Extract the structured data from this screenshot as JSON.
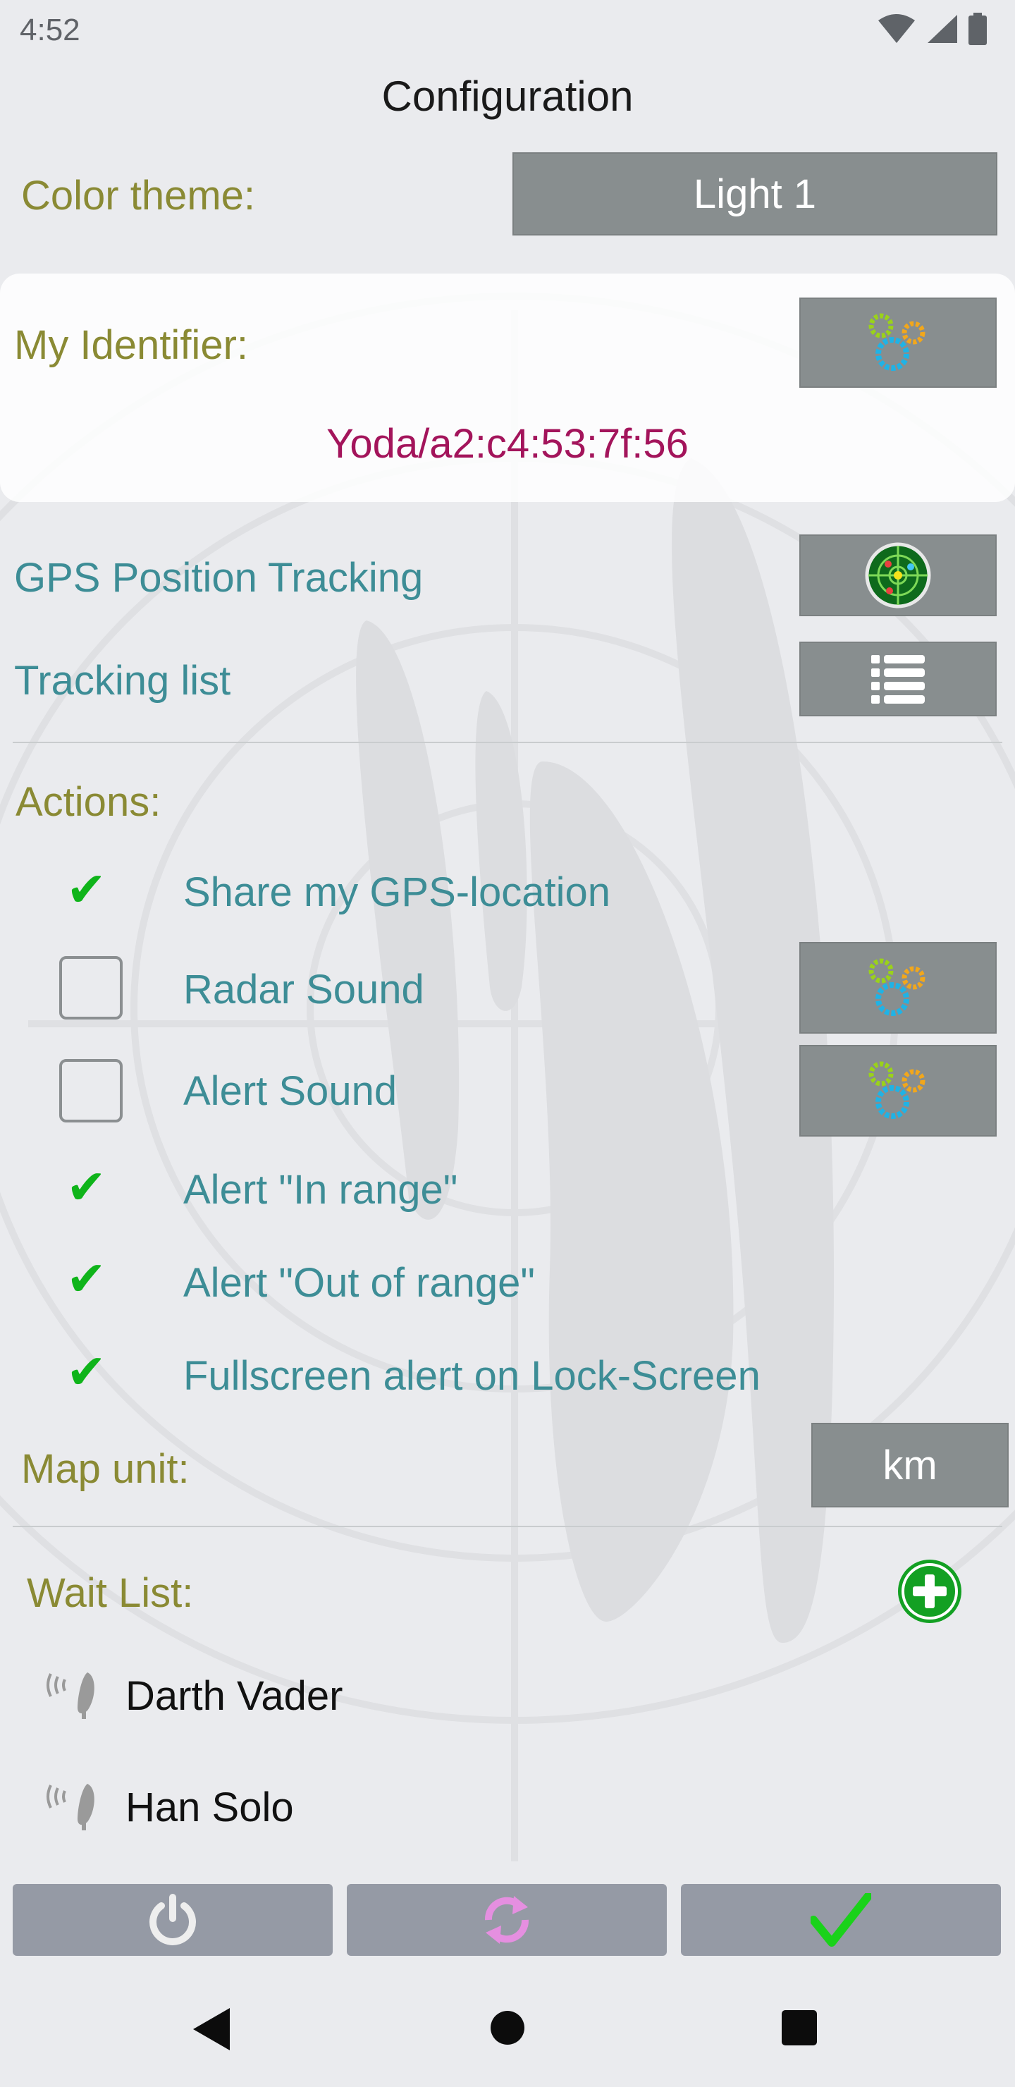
{
  "status_bar": {
    "time": "4:52",
    "icons": [
      "wifi-icon",
      "cell-signal-icon",
      "battery-icon"
    ]
  },
  "header": {
    "title": "Configuration"
  },
  "color_theme": {
    "label": "Color theme:",
    "value": "Light 1"
  },
  "identifier": {
    "label": "My Identifier:",
    "value": "Yoda/a2:c4:53:7f:56",
    "button_icon": "gears-icon"
  },
  "gps_tracking": {
    "label": "GPS Position Tracking",
    "button_icon": "radar-icon"
  },
  "tracking_list": {
    "label": "Tracking list",
    "button_icon": "list-icon"
  },
  "actions": {
    "heading": "Actions:",
    "items": [
      {
        "label": "Share my GPS-location",
        "checked": true
      },
      {
        "label": "Radar Sound",
        "checked": false,
        "settings_icon": "gears-icon"
      },
      {
        "label": "Alert Sound",
        "checked": false,
        "settings_icon": "gears-icon"
      },
      {
        "label": "Alert \"In range\"",
        "checked": true
      },
      {
        "label": "Alert \"Out of range\"",
        "checked": true
      },
      {
        "label": "Fullscreen alert on Lock-Screen",
        "checked": true
      }
    ]
  },
  "map_unit": {
    "label": "Map unit:",
    "value": "km"
  },
  "wait_list": {
    "heading": "Wait List:",
    "add_icon": "add-circle-icon",
    "entries": [
      {
        "name": "Darth Vader",
        "icon": "antenna-icon"
      },
      {
        "name": "Han Solo",
        "icon": "antenna-icon"
      }
    ]
  },
  "bottom_bar": {
    "buttons": [
      {
        "icon": "power-icon"
      },
      {
        "icon": "sync-icon"
      },
      {
        "icon": "checkmark-icon"
      }
    ]
  },
  "nav_bar": {
    "icons": [
      "back-icon",
      "home-icon",
      "recents-icon"
    ]
  },
  "colors": {
    "background": "#eaebee",
    "olive_label": "#8a8a34",
    "teal_label": "#3d8d96",
    "identifier_value": "#a3145b",
    "check_green": "#0fb41a",
    "button_gray": "#888e8f"
  }
}
